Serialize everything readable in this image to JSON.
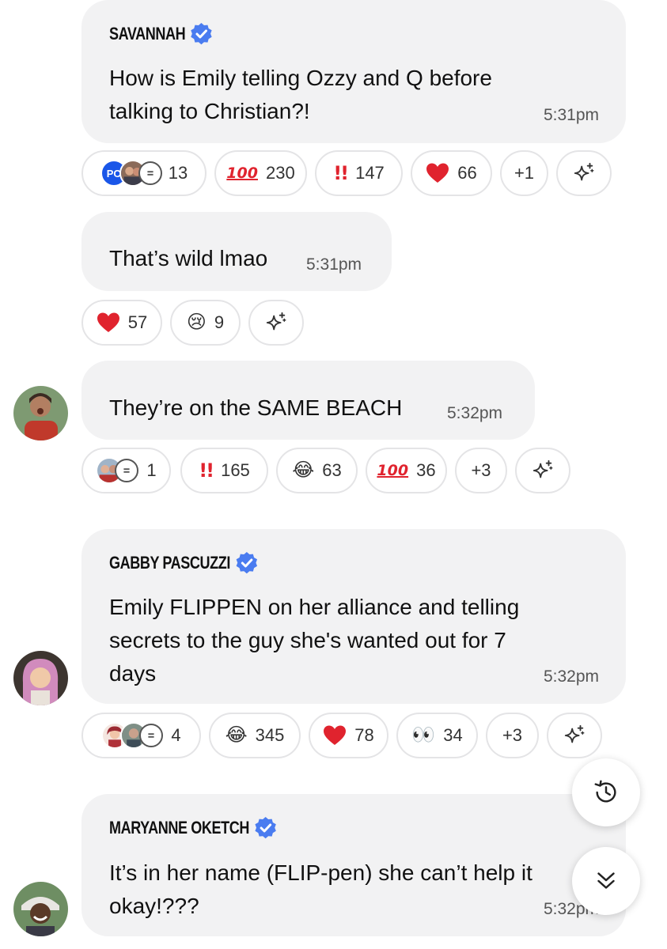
{
  "messages": [
    {
      "sender": "SAVANNAH",
      "text_lines": [
        "How is Emily telling Ozzy and Q before",
        "talking to Christian?!"
      ],
      "time": "5:31pm",
      "thread": {
        "initials": "PC",
        "count": "13"
      },
      "reactions": [
        {
          "icon": "hundred-emoji",
          "count": "230"
        },
        {
          "icon": "double-exclamation-emoji",
          "count": "147"
        },
        {
          "icon": "red-heart-emoji",
          "count": "66"
        },
        {
          "icon": "more",
          "count": "+1"
        }
      ]
    },
    {
      "text_lines": [
        "That’s wild lmao"
      ],
      "time": "5:31pm",
      "reactions": [
        {
          "icon": "red-heart-emoji",
          "count": "57"
        },
        {
          "icon": "crying-face-emoji",
          "count": "9"
        }
      ]
    },
    {
      "text_lines": [
        "They’re on the SAME BEACH"
      ],
      "time": "5:32pm",
      "thread": {
        "count": "1"
      },
      "reactions": [
        {
          "icon": "double-exclamation-emoji",
          "count": "165"
        },
        {
          "icon": "tears-of-joy-emoji",
          "count": "63"
        },
        {
          "icon": "hundred-emoji",
          "count": "36"
        },
        {
          "icon": "more",
          "count": "+3"
        }
      ]
    },
    {
      "sender": "GABBY PASCUZZI",
      "text_lines": [
        "Emily FLIPPEN on her alliance and telling",
        "secrets to the guy she's wanted out for 7",
        "days"
      ],
      "time": "5:32pm",
      "thread": {
        "count": "4"
      },
      "reactions": [
        {
          "icon": "tears-of-joy-emoji",
          "count": "345"
        },
        {
          "icon": "red-heart-emoji",
          "count": "78"
        },
        {
          "icon": "eyes-emoji",
          "count": "34"
        },
        {
          "icon": "more",
          "count": "+3"
        }
      ]
    },
    {
      "sender": "MARYANNE OKETCH",
      "text_lines": [
        "It’s in her name (FLIP-pen) she can’t help it",
        "okay!???"
      ],
      "time": "5:32pm"
    }
  ],
  "emoji_glyphs": {
    "hundred": "100",
    "double_exclamation": "!!",
    "heart": "❤",
    "crying": "😢",
    "joy": "😂",
    "eyes": "👀"
  },
  "colors": {
    "bubble": "#f2f2f3",
    "verified_blue": "#4a7cf0",
    "emoji_red": "#e0232e"
  },
  "floating_buttons": [
    "history-icon",
    "double-chevron-down-icon"
  ]
}
